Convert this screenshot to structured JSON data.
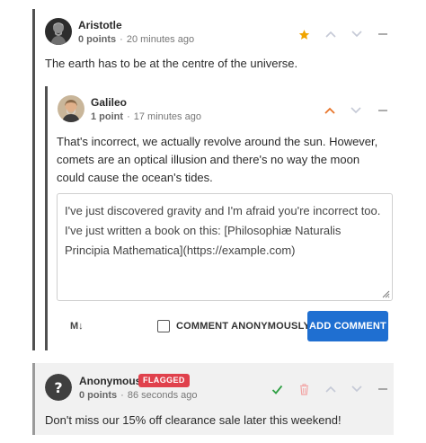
{
  "comments": [
    {
      "author": "Aristotle",
      "points": "0 points",
      "time": "20 minutes ago",
      "text": "The earth has to be at the centre of the universe.",
      "avatar_icon": "bust-portrait-icon",
      "starred": true
    },
    {
      "author": "Galileo",
      "points": "1 point",
      "time": "17 minutes ago",
      "text": "That's incorrect, we actually revolve around the sun. However, comets are an optical illusion and there's no way the moon could cause the ocean's tides.",
      "avatar_icon": "painted-portrait-icon",
      "upvoted": true
    },
    {
      "author": "Anonymous",
      "badge": "FLAGGED",
      "points": "0 points",
      "time": "86 seconds ago",
      "text": "Don't miss our 15% off clearance sale later this weekend!",
      "avatar_icon": "question-mark-icon"
    }
  ],
  "reply": {
    "text": "I've just discovered gravity and I'm afraid you're incorrect too. I've just written a book on this: [Philosophiæ Naturalis Principia Mathematica](https://example.com)",
    "markdown_label": "M↓",
    "anonymous_label": "COMMENT ANONYMOUSLY",
    "anonymous_checked": false,
    "submit_label": "ADD COMMENT"
  },
  "colors": {
    "star": "#f0a400",
    "upvote_active": "#e8742a",
    "vote_idle": "#c5c9d6",
    "approve": "#2ea043",
    "delete": "#f2a2a2",
    "flag_badge": "#e0414c",
    "button": "#1f6fd1"
  }
}
